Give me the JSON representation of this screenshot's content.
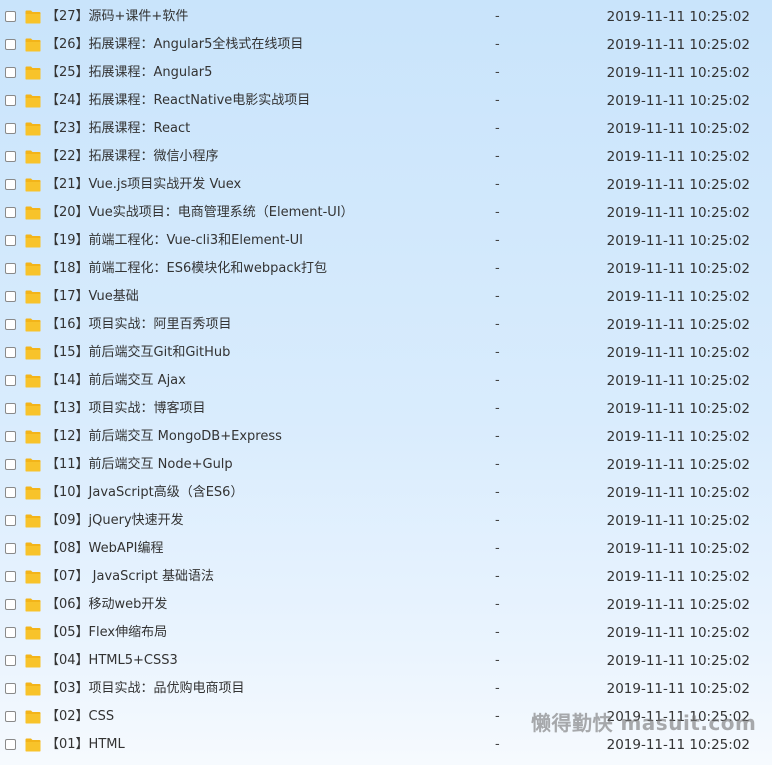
{
  "files": [
    {
      "name": "【27】源码+课件+软件",
      "size": "-",
      "date": "2019-11-11 10:25:02",
      "icon": "folder-icon"
    },
    {
      "name": "【26】拓展课程：Angular5全栈式在线项目",
      "size": "-",
      "date": "2019-11-11 10:25:02",
      "icon": "folder-icon"
    },
    {
      "name": "【25】拓展课程：Angular5",
      "size": "-",
      "date": "2019-11-11 10:25:02",
      "icon": "folder-icon"
    },
    {
      "name": "【24】拓展课程：ReactNative电影实战项目",
      "size": "-",
      "date": "2019-11-11 10:25:02",
      "icon": "folder-icon"
    },
    {
      "name": "【23】拓展课程：React",
      "size": "-",
      "date": "2019-11-11 10:25:02",
      "icon": "folder-icon"
    },
    {
      "name": "【22】拓展课程：微信小程序",
      "size": "-",
      "date": "2019-11-11 10:25:02",
      "icon": "folder-icon"
    },
    {
      "name": "【21】Vue.js项目实战开发 Vuex",
      "size": "-",
      "date": "2019-11-11 10:25:02",
      "icon": "folder-icon"
    },
    {
      "name": "【20】Vue实战项目：电商管理系统（Element-UI）",
      "size": "-",
      "date": "2019-11-11 10:25:02",
      "icon": "folder-icon"
    },
    {
      "name": "【19】前端工程化：Vue-cli3和Element-UI",
      "size": "-",
      "date": "2019-11-11 10:25:02",
      "icon": "folder-icon"
    },
    {
      "name": "【18】前端工程化：ES6模块化和webpack打包",
      "size": "-",
      "date": "2019-11-11 10:25:02",
      "icon": "folder-icon"
    },
    {
      "name": "【17】Vue基础",
      "size": "-",
      "date": "2019-11-11 10:25:02",
      "icon": "folder-icon"
    },
    {
      "name": "【16】项目实战：阿里百秀项目",
      "size": "-",
      "date": "2019-11-11 10:25:02",
      "icon": "folder-icon"
    },
    {
      "name": "【15】前后端交互Git和GitHub",
      "size": "-",
      "date": "2019-11-11 10:25:02",
      "icon": "folder-icon"
    },
    {
      "name": "【14】前后端交互 Ajax",
      "size": "-",
      "date": "2019-11-11 10:25:02",
      "icon": "folder-icon"
    },
    {
      "name": "【13】项目实战：博客项目",
      "size": "-",
      "date": "2019-11-11 10:25:02",
      "icon": "folder-icon"
    },
    {
      "name": "【12】前后端交互 MongoDB+Express",
      "size": "-",
      "date": "2019-11-11 10:25:02",
      "icon": "folder-icon"
    },
    {
      "name": "【11】前后端交互 Node+Gulp",
      "size": "-",
      "date": "2019-11-11 10:25:02",
      "icon": "folder-icon"
    },
    {
      "name": "【10】JavaScript高级（含ES6）",
      "size": "-",
      "date": "2019-11-11 10:25:02",
      "icon": "folder-icon"
    },
    {
      "name": "【09】jQuery快速开发",
      "size": "-",
      "date": "2019-11-11 10:25:02",
      "icon": "folder-icon"
    },
    {
      "name": "【08】WebAPI编程",
      "size": "-",
      "date": "2019-11-11 10:25:02",
      "icon": "folder-icon"
    },
    {
      "name": "【07】 JavaScript 基础语法",
      "size": "-",
      "date": "2019-11-11 10:25:02",
      "icon": "folder-icon"
    },
    {
      "name": "【06】移动web开发",
      "size": "-",
      "date": "2019-11-11 10:25:02",
      "icon": "folder-icon"
    },
    {
      "name": "【05】Flex伸缩布局",
      "size": "-",
      "date": "2019-11-11 10:25:02",
      "icon": "folder-icon"
    },
    {
      "name": "【04】HTML5+CSS3",
      "size": "-",
      "date": "2019-11-11 10:25:02",
      "icon": "folder-icon"
    },
    {
      "name": "【03】项目实战：品优购电商项目",
      "size": "-",
      "date": "2019-11-11 10:25:02",
      "icon": "folder-icon"
    },
    {
      "name": "【02】CSS",
      "size": "-",
      "date": "2019-11-11 10:25:02",
      "icon": "folder-icon"
    },
    {
      "name": "【01】HTML",
      "size": "-",
      "date": "2019-11-11 10:25:02",
      "icon": "folder-icon"
    }
  ],
  "watermark": "懒得勤快 masuit.com",
  "colors": {
    "folder": "#f8c32a",
    "folder_tab": "#f3b419",
    "text": "#333333"
  }
}
